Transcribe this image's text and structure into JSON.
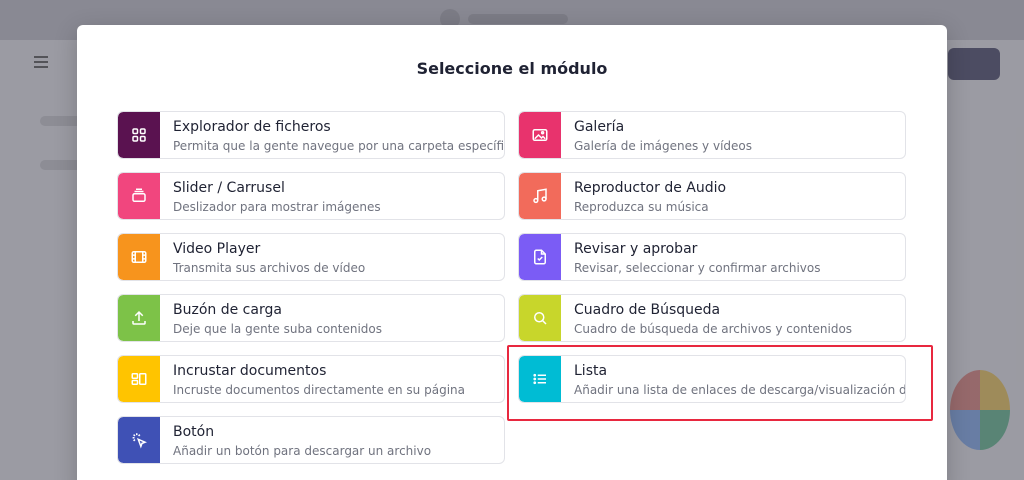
{
  "modal": {
    "title": "Seleccione el módulo"
  },
  "modules": [
    {
      "id": "explorador",
      "title": "Explorador de ficheros",
      "subtitle": "Permita que la gente navegue por una carpeta específica",
      "icon": "grid-icon",
      "color": "#5a1250"
    },
    {
      "id": "galeria",
      "title": "Galería",
      "subtitle": "Galería de imágenes y vídeos",
      "icon": "image-icon",
      "color": "#e8336d"
    },
    {
      "id": "slider",
      "title": "Slider / Carrusel",
      "subtitle": "Deslizador para mostrar imágenes",
      "icon": "layers-icon",
      "color": "#f1467e"
    },
    {
      "id": "audio",
      "title": "Reproductor de Audio",
      "subtitle": "Reproduzca su música",
      "icon": "music-icon",
      "color": "#f26b5b"
    },
    {
      "id": "video",
      "title": "Video Player",
      "subtitle": "Transmita sus archivos de vídeo",
      "icon": "film-icon",
      "color": "#f7941d"
    },
    {
      "id": "revisar",
      "title": "Revisar y aprobar",
      "subtitle": "Revisar, seleccionar y confirmar archivos",
      "icon": "file-check-icon",
      "color": "#7b5cf5"
    },
    {
      "id": "buzon",
      "title": "Buzón de carga",
      "subtitle": "Deje que la gente suba contenidos",
      "icon": "upload-icon",
      "color": "#7dc248"
    },
    {
      "id": "busqueda",
      "title": "Cuadro de Búsqueda",
      "subtitle": "Cuadro de búsqueda de archivos y contenidos",
      "icon": "search-icon",
      "color": "#c8d62b"
    },
    {
      "id": "incrustar",
      "title": "Incrustar documentos",
      "subtitle": "Incruste documentos directamente en su página",
      "icon": "embed-icon",
      "color": "#ffc400"
    },
    {
      "id": "lista",
      "title": "Lista",
      "subtitle": "Añadir una lista de enlaces de descarga/visualización de archivos",
      "icon": "list-icon",
      "color": "#00bcd4"
    },
    {
      "id": "boton",
      "title": "Botón",
      "subtitle": "Añadir un botón para descargar un archivo",
      "icon": "cursor-click-icon",
      "color": "#3f51b5"
    }
  ]
}
